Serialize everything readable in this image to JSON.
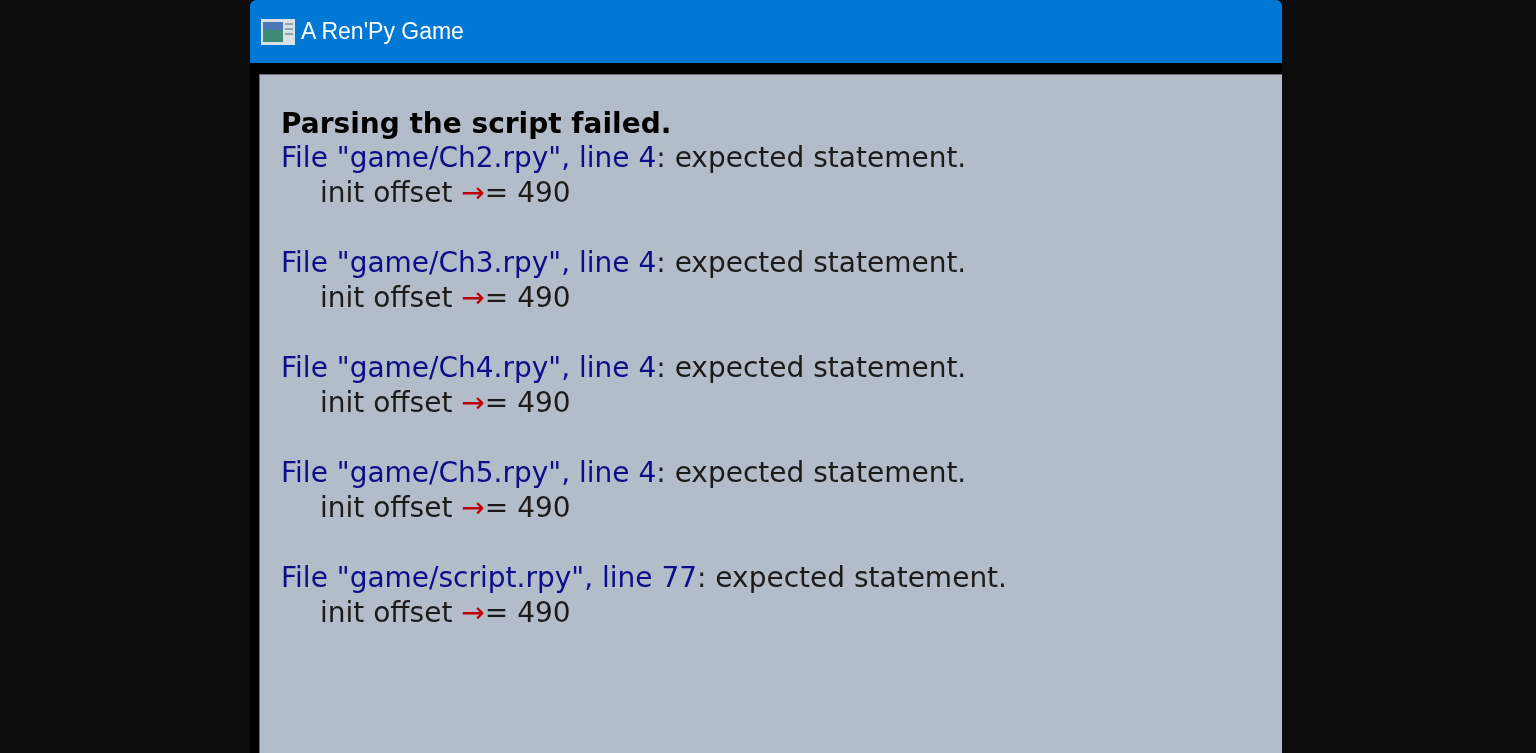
{
  "window": {
    "title": "A Ren'Py Game"
  },
  "heading": "Parsing the script failed.",
  "errors": [
    {
      "location": "File \"game/Ch2.rpy\", line 4",
      "message": ": expected statement.",
      "code_before": "init offset ",
      "marker": "→",
      "code_after": "= 490"
    },
    {
      "location": "File \"game/Ch3.rpy\", line 4",
      "message": ": expected statement.",
      "code_before": "init offset ",
      "marker": "→",
      "code_after": "= 490"
    },
    {
      "location": "File \"game/Ch4.rpy\", line 4",
      "message": ": expected statement.",
      "code_before": "init offset ",
      "marker": "→",
      "code_after": "= 490"
    },
    {
      "location": "File \"game/Ch5.rpy\", line 4",
      "message": ": expected statement.",
      "code_before": "init offset ",
      "marker": "→",
      "code_after": "= 490"
    },
    {
      "location": "File \"game/script.rpy\", line 77",
      "message": ": expected statement.",
      "code_before": "init offset ",
      "marker": "→",
      "code_after": "= 490"
    }
  ]
}
